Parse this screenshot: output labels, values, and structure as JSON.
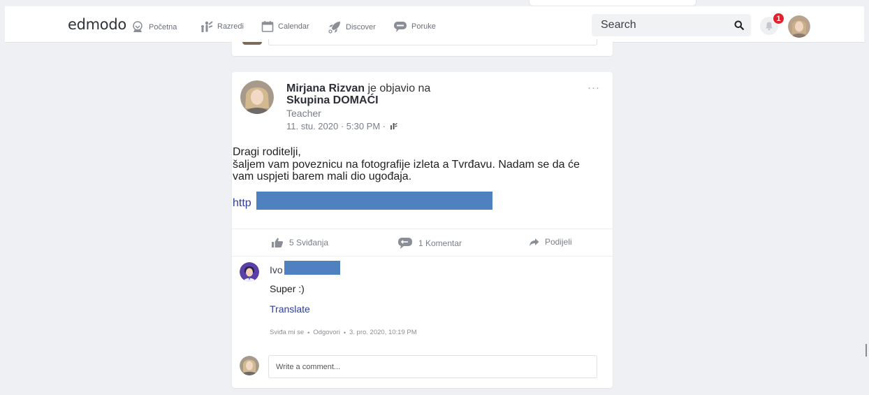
{
  "navbar": {
    "logo": "edmodo",
    "items": [
      {
        "label": "Početna",
        "icon": "home-icon"
      },
      {
        "label": "Razredi",
        "icon": "classes-icon"
      },
      {
        "label": "Calendar",
        "icon": "calendar-icon"
      },
      {
        "label": "Discover",
        "icon": "rocket-icon"
      },
      {
        "label": "Poruke",
        "icon": "message-icon"
      }
    ],
    "search_placeholder": "Search",
    "notification_count": "1"
  },
  "post": {
    "author": "Mirjana Rizvan",
    "posted_in_text": "je objavio na",
    "group": "Skupina DOMAĆI",
    "role": "Teacher",
    "time": "11. stu. 2020 · 5:30 PM ·",
    "menu": "···",
    "body_lines": [
      "Dragi roditelji,",
      "šaljem vam poveznicu na fotografije izleta a Tvrđavu. Nadam se da će",
      "vam uspjeti barem mali dio ugođaja."
    ],
    "link_prefix": "http",
    "actions": {
      "likes": "5 Sviđanja",
      "comments": "1 Komentar",
      "share": "Podijeli"
    }
  },
  "comment": {
    "author": "Ivo",
    "text": "Super :)",
    "translate": "Translate",
    "like": "Sviđa mi se",
    "reply": "Odgovori",
    "time": "3. pro. 2020, 10:19 PM"
  },
  "composer": {
    "placeholder": "Write a comment..."
  },
  "colors": {
    "accent_link": "#2e3e9a",
    "redaction": "#4f80c0",
    "badge": "#e5202e",
    "background": "#eef0f3"
  }
}
